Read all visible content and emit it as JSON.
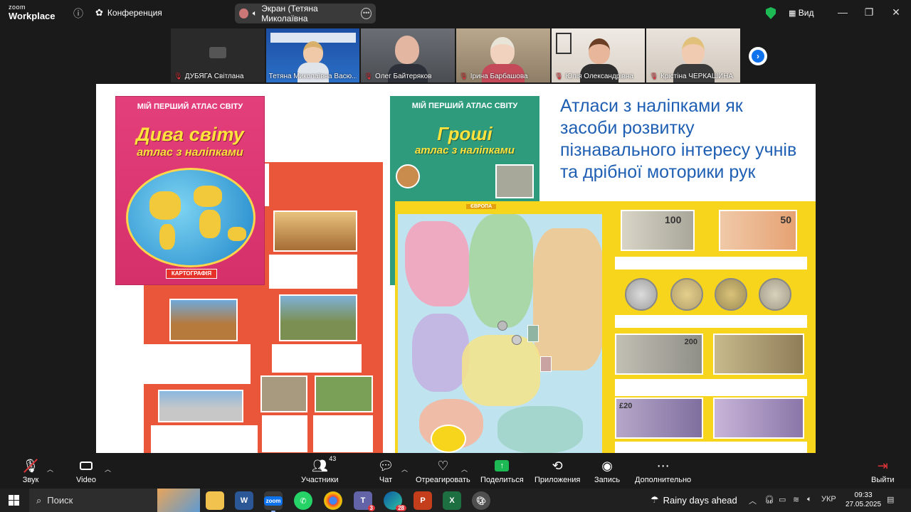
{
  "app": {
    "brand_line1": "zoom",
    "brand_line2": "Workplace",
    "conference_label": "Конференция",
    "share_label": "Экран (Тетяна Миколаївна",
    "view_label": "Вид"
  },
  "participants": [
    {
      "name": "ДУБЯГА Світлана"
    },
    {
      "name": "Тетяна Миколаївна Васю..."
    },
    {
      "name": "Олег Байтеряков"
    },
    {
      "name": "Ірина Барбашова"
    },
    {
      "name": "Юлія Олександрівна"
    },
    {
      "name": "Крістіна ЧЕРКАШИНА"
    }
  ],
  "slide": {
    "title": "Атласи з наліпками як засоби розвитку пізнавального інтересу учнів та дрібної моторики рук",
    "book1_header": "МІЙ ПЕРШИЙ АТЛАС СВІТУ",
    "book1_title": "Дива світу",
    "book1_subtitle": "атлас з наліпками",
    "book1_logo": "КАРТОГРАФІЯ",
    "book2_header": "МІЙ ПЕРШИЙ АТЛАС СВІТУ",
    "book2_title": "Гроші",
    "book2_subtitle": "атлас з наліпками",
    "map_label": "ЄВРОПА",
    "note_100": "100",
    "note_50": "50",
    "note_200": "200",
    "note_20": "£20"
  },
  "controls": {
    "mute": "Звук",
    "video": "Video",
    "participants": "Участники",
    "participants_count": "43",
    "chat": "Чат",
    "react": "Отреагировать",
    "share": "Поделиться",
    "apps": "Приложения",
    "record": "Запись",
    "more": "Дополнительно",
    "leave": "Выйти"
  },
  "taskbar": {
    "search_placeholder": "Поиск",
    "weather": "Rainy days ahead",
    "lang": "УКР",
    "time": "09:33",
    "date": "27.05.2025",
    "teams_badge": "3",
    "edge_badge": "28"
  }
}
